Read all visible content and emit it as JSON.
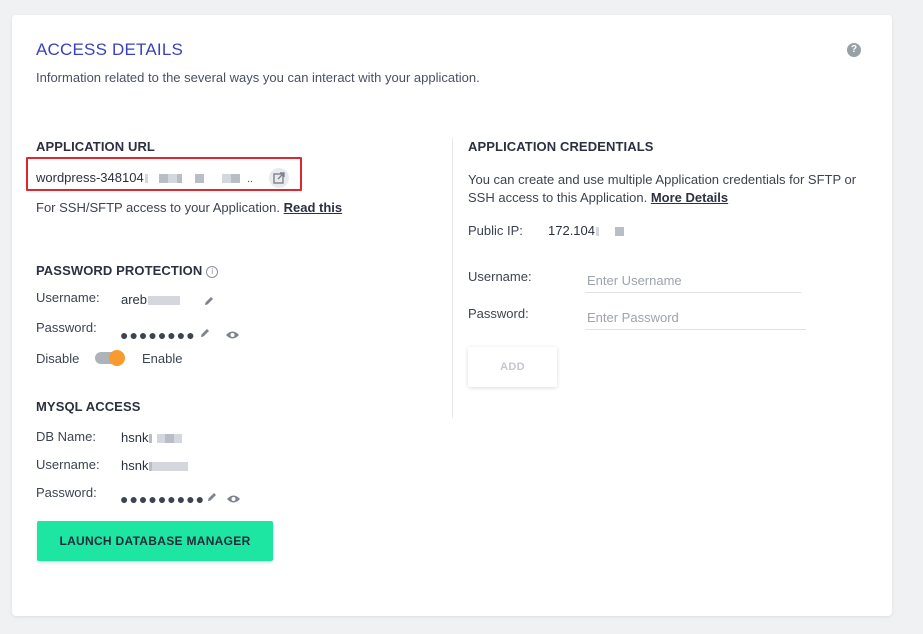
{
  "header": {
    "title": "ACCESS DETAILS",
    "subtitle": "Information related to the several ways you can interact with your application.",
    "help_glyph": "?"
  },
  "app_url": {
    "heading": "APPLICATION URL",
    "url_visible": "wordpress-348104",
    "ssh_note": "For SSH/SFTP access to your Application.",
    "read_this": "Read this"
  },
  "password_protection": {
    "heading": "PASSWORD PROTECTION",
    "username_label": "Username:",
    "username_value": "areb",
    "password_label": "Password:",
    "password_dots": "●●●●●●●●",
    "disable_label": "Disable",
    "enable_label": "Enable",
    "enabled": true
  },
  "mysql": {
    "heading": "MYSQL ACCESS",
    "db_label": "DB Name:",
    "db_value": "hsnk",
    "username_label": "Username:",
    "username_value": "hsnk",
    "password_label": "Password:",
    "password_dots": "●●●●●●●●●",
    "launch_label": "LAUNCH DATABASE MANAGER"
  },
  "credentials": {
    "heading": "APPLICATION CREDENTIALS",
    "desc": "You can create and use multiple Application credentials for SFTP or SSH access to this Application.",
    "more_details": "More Details",
    "public_ip_label": "Public IP:",
    "public_ip_value": "172.104",
    "username_label": "Username:",
    "username_placeholder": "Enter Username",
    "password_label": "Password:",
    "password_placeholder": "Enter Password",
    "add_label": "ADD"
  },
  "colors": {
    "title": "#3b40c0",
    "highlight_border": "#e0262f",
    "toggle_knob": "#f79b2e",
    "launch_bg": "#1ce6a1"
  }
}
